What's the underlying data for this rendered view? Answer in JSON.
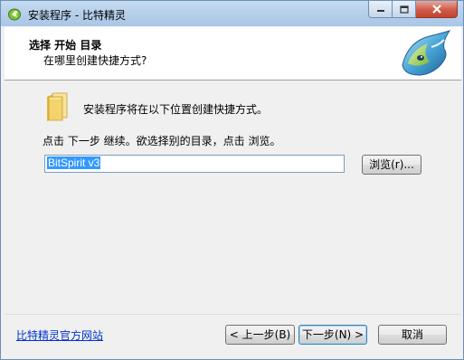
{
  "window": {
    "title": "安装程序 - 比特精灵",
    "controls": {
      "minimize": "minimize",
      "maximize": "maximize",
      "close": "close"
    }
  },
  "header": {
    "title": "选择 开始 目录",
    "subtitle": "在哪里创建快捷方式?"
  },
  "body": {
    "info_text": "安装程序将在以下位置创建快捷方式。",
    "instruction_text": "点击 下一步 继续。欲选择别的目录，点击 浏览。",
    "path_value": "BitSpirit v3",
    "browse_label": "浏览(r)..."
  },
  "footer": {
    "website_link": "比特精灵官方网站",
    "back_label": "< 上一步(B)",
    "next_label": "下一步(N) >",
    "cancel_label": "取消"
  },
  "icons": {
    "app": "bitspirit-app-icon",
    "logo": "bitspirit-logo",
    "folder": "folder-icon"
  },
  "colors": {
    "link": "#0033cc",
    "selection": "#3399ff",
    "header_bg": "#ffffff",
    "dialog_bg": "#f0f0f0"
  }
}
